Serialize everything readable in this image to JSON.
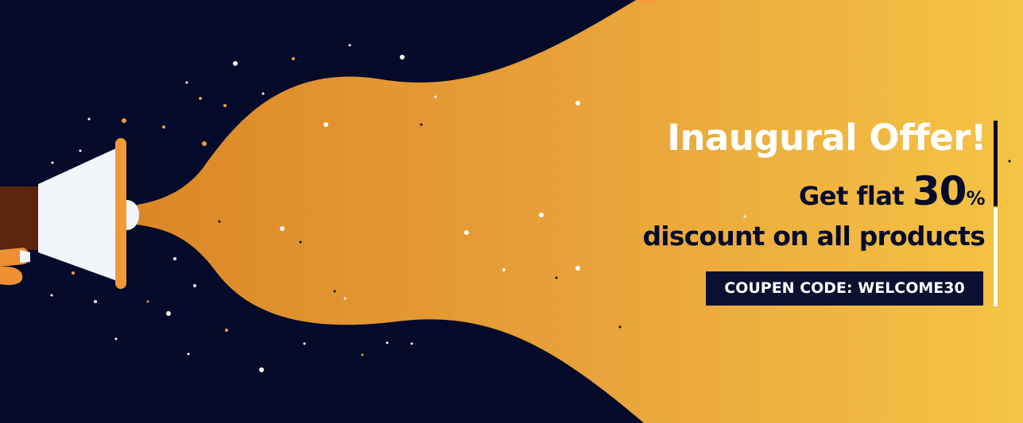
{
  "banner": {
    "headline": "Inaugural Offer!",
    "offer_prefix": "Get flat ",
    "offer_value": "30",
    "offer_percent": "%",
    "offer_line2": "discount on all products",
    "coupon_text": "COUPEN CODE: WELCOME30"
  },
  "colors": {
    "background": "#030a2a",
    "beam_start": "#dc8727",
    "beam_end": "#f5c445",
    "headline_text": "#ffffff",
    "offer_text": "#030a2a",
    "coupon_bg": "#0b1030",
    "megaphone_body": "#f2f6fa",
    "megaphone_rim": "#f29a3a",
    "hand": "#5a2610"
  },
  "icons": {
    "megaphone": "megaphone-icon",
    "hand": "hand-icon"
  }
}
